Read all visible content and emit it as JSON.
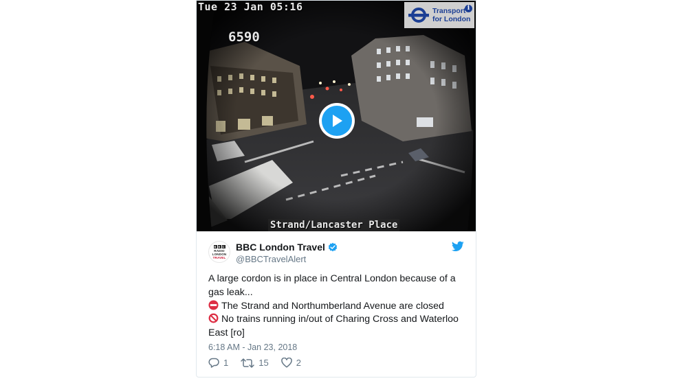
{
  "video": {
    "timestamp": "Tue 23 Jan 05:16",
    "camera_id": "6590",
    "location": "Strand/Lancaster Place",
    "logo": {
      "line1": "Transport",
      "line2": "for London",
      "info_glyph": "i",
      "brand_color": "#1c3f94"
    },
    "play_icon": "play-icon",
    "accent_color": "#1da1f2"
  },
  "author": {
    "display_name": "BBC London Travel",
    "handle": "@BBCTravelAlert",
    "verified_icon": "verified-badge-icon",
    "avatar_lines": [
      "BBC",
      "RADIO",
      "LONDON",
      "TRAVEL"
    ]
  },
  "tweet": {
    "lines": [
      "A large cordon is in place in Central London because of a",
      "gas leak...",
      "The Strand and Northumberland Avenue are closed",
      "No trains running in/out of Charing Cross and Waterloo",
      "East [ro]"
    ],
    "emojis": [
      "no-entry-icon",
      "prohibited-icon"
    ],
    "timestamp": "6:18 AM - Jan 23, 2018"
  },
  "actions": {
    "replies": "1",
    "retweets": "15",
    "likes": "2"
  },
  "colors": {
    "text": "#14171a",
    "muted": "#657786",
    "twitter_blue": "#1da1f2",
    "border": "#e1e8ed"
  }
}
